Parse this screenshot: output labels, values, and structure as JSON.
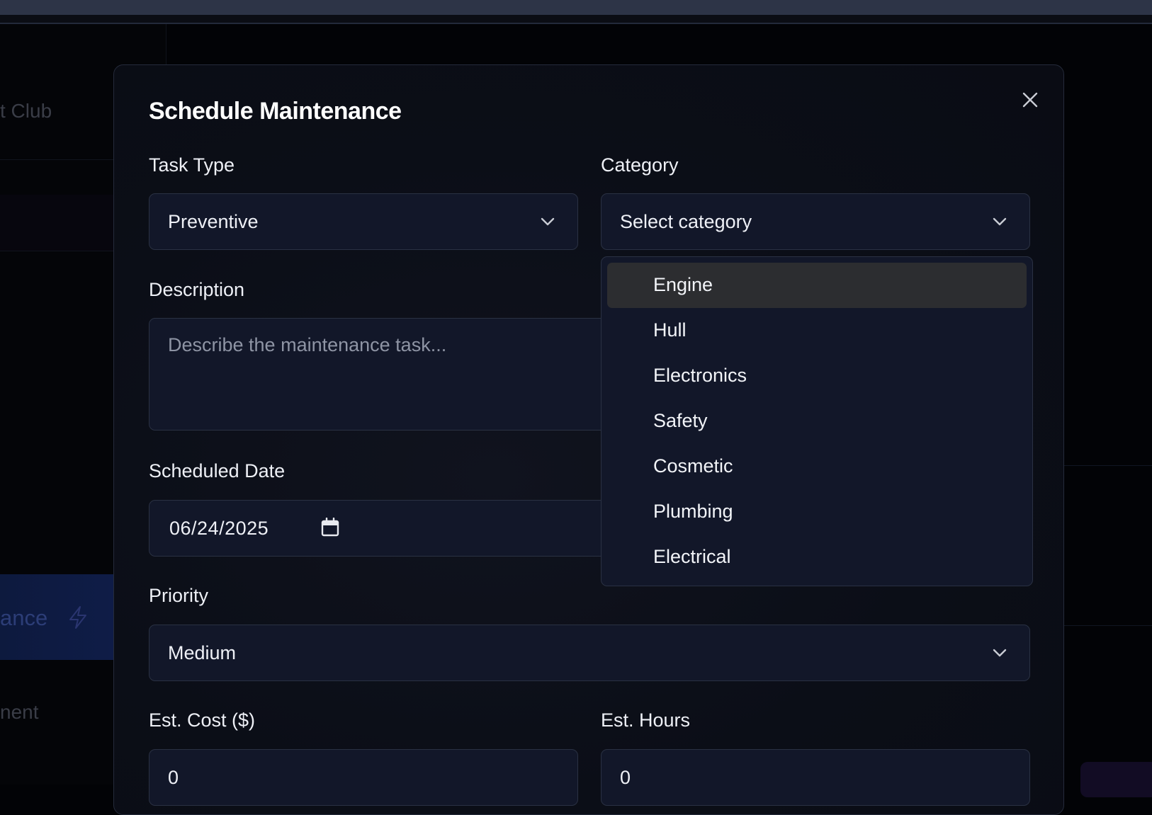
{
  "background": {
    "sidebar_fragment_top": "t Club",
    "sidebar_fragment_active": "ance",
    "sidebar_fragment_bottom": "nent"
  },
  "modal": {
    "title": "Schedule Maintenance",
    "close_icon": "close-icon",
    "task_type": {
      "label": "Task Type",
      "value": "Preventive"
    },
    "category": {
      "label": "Category",
      "placeholder": "Select category"
    },
    "description": {
      "label": "Description",
      "placeholder": "Describe the maintenance task..."
    },
    "scheduled_date": {
      "label": "Scheduled Date",
      "value": "06/24/2025"
    },
    "priority": {
      "label": "Priority",
      "value": "Medium"
    },
    "est_cost": {
      "label": "Est. Cost ($)",
      "value": "0"
    },
    "est_hours": {
      "label": "Est. Hours",
      "value": "0"
    }
  },
  "category_dropdown": {
    "highlighted": "Engine",
    "options": [
      "Engine",
      "Hull",
      "Electronics",
      "Safety",
      "Cosmetic",
      "Plumbing",
      "Electrical"
    ]
  },
  "colors": {
    "modal_bg": "#0b0e17",
    "field_bg": "#121729",
    "field_border": "#2a3143",
    "highlight_bg": "#2c2d30",
    "active_nav_bg": "#0f1c47"
  }
}
